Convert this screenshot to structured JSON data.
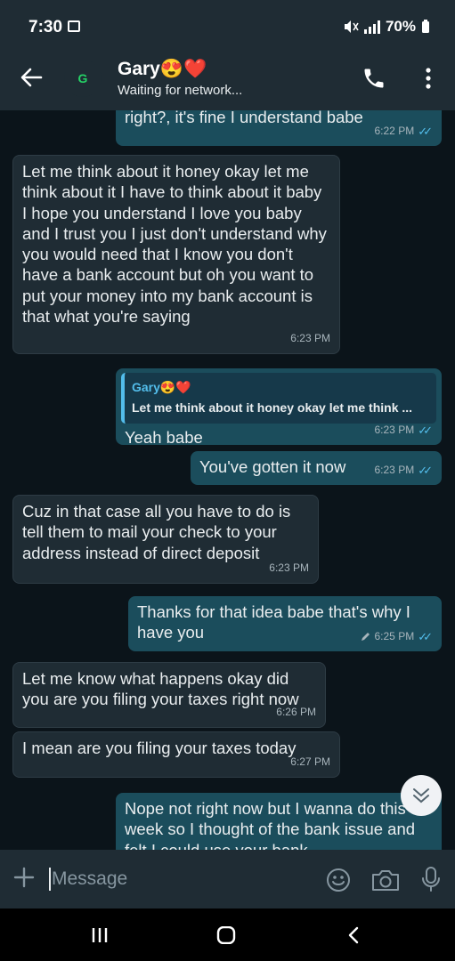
{
  "status": {
    "time": "7:30",
    "battery": "70%"
  },
  "header": {
    "name": "Gary",
    "name_emojis": "😍❤️",
    "status": "Waiting for network...",
    "avatar_letter": "G"
  },
  "messages": [
    {
      "dir": "out",
      "text": "right?, it's fine I understand babe",
      "time": "6:22 PM"
    },
    {
      "dir": "in",
      "text": "Let me think about it honey okay let me think about it I have to think about it baby I hope you understand I love you baby and I trust you I just don't understand why you would need that I know you don't have a bank account but oh you want to put your money into my bank account is that what you're saying",
      "time": "6:23 PM"
    },
    {
      "dir": "out",
      "quote_name": "Gary😍❤️",
      "quote_text": "Let me think about it honey okay let me think ...",
      "text": "Yeah babe",
      "time": "6:23 PM"
    },
    {
      "dir": "out",
      "text": "You've gotten it now",
      "time": "6:23 PM"
    },
    {
      "dir": "in",
      "text": "Cuz in that case all you have to do is tell them to mail your check to your address instead of direct deposit",
      "time": "6:23 PM"
    },
    {
      "dir": "out",
      "text": "Thanks for that idea babe that's why I have you",
      "time": "6:25 PM",
      "edited": true
    },
    {
      "dir": "in",
      "text": "Let me know what happens okay did you are you filing your taxes right now",
      "time": "6:26 PM"
    },
    {
      "dir": "in",
      "text": "I mean are you filing your taxes today",
      "time": "6:27 PM"
    },
    {
      "dir": "out",
      "text": "Nope not right now but I wanna do this week so I thought of the bank issue and felt I could use your bank"
    }
  ],
  "input": {
    "placeholder": "Message"
  }
}
